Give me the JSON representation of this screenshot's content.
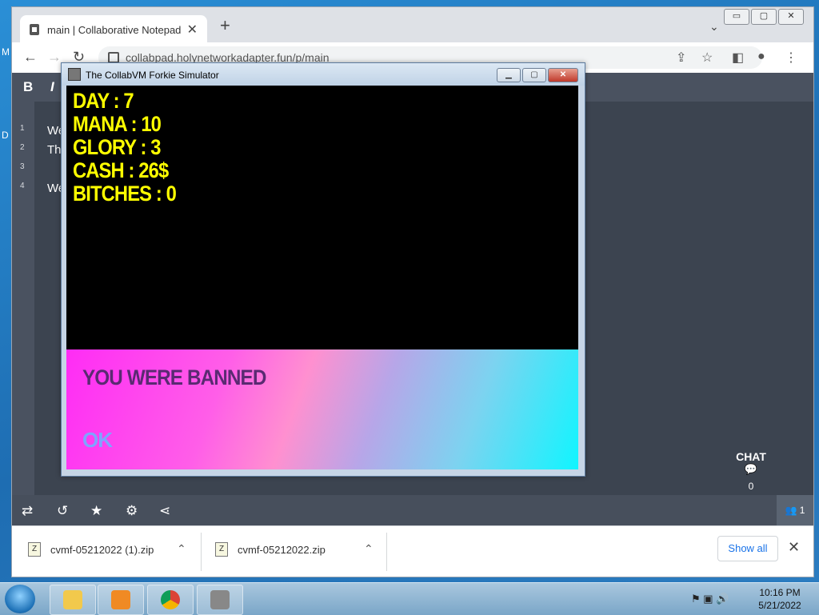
{
  "desktop_letters": [
    "M",
    "D"
  ],
  "browser": {
    "tab_title": "main | Collaborative Notepad",
    "tab_close": "✕",
    "new_tab": "+",
    "tab_list": "⌄",
    "window_buttons": [
      "▭",
      "▢",
      "✕"
    ],
    "url": "collabpad.holynetworkadapter.fun/p/main"
  },
  "notepad": {
    "format_buttons": [
      "B",
      "I"
    ],
    "line_numbers": [
      "1",
      "2",
      "3",
      "4"
    ],
    "lines": [
      "We",
      "Th",
      "",
      "We"
    ],
    "chat_label": "CHAT",
    "chat_count": "0",
    "users_count": "1"
  },
  "downloads": {
    "items": [
      {
        "name": "cvmf-05212022 (1).zip"
      },
      {
        "name": "cvmf-05212022.zip"
      }
    ],
    "show_all": "Show all"
  },
  "game": {
    "window_title": "The CollabVM Forkie Simulator",
    "stats": [
      "DAY : 7",
      "MANA : 10",
      "GLORY : 3",
      "CASH : 26$",
      "BITCHES : 0"
    ],
    "message": "YOU WERE BANNED",
    "ok_label": "OK"
  },
  "taskbar": {
    "time": "10:16 PM",
    "date": "5/21/2022"
  }
}
